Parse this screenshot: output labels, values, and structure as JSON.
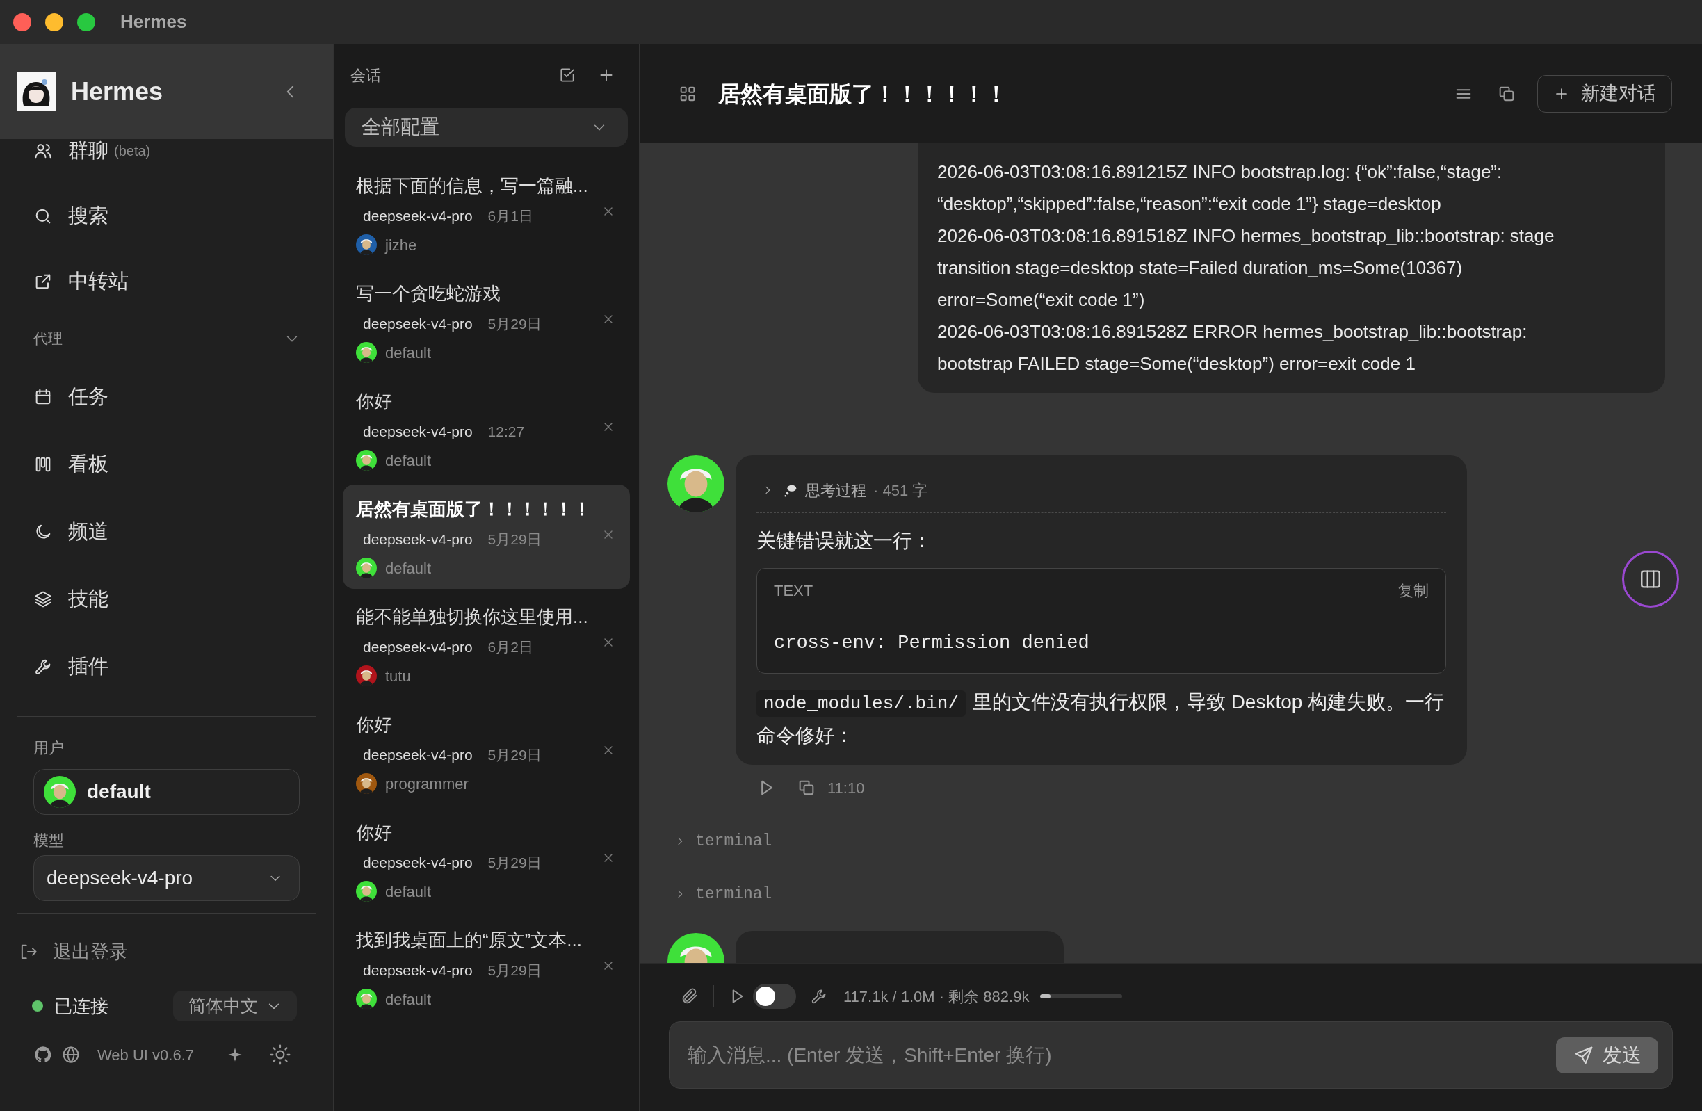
{
  "window": {
    "title": "Hermes"
  },
  "sidebar": {
    "app_name": "Hermes",
    "nav": [
      {
        "label": "群聊",
        "badge": "(beta)"
      },
      {
        "label": "搜索"
      },
      {
        "label": "中转站"
      }
    ],
    "sections": [
      {
        "title": "代理",
        "expanded": true,
        "items": [
          {
            "label": "任务"
          },
          {
            "label": "看板"
          },
          {
            "label": "频道"
          },
          {
            "label": "技能"
          },
          {
            "label": "插件"
          }
        ]
      }
    ],
    "user": {
      "label": "用户",
      "name": "default"
    },
    "model": {
      "label": "模型",
      "value": "deepseek-v4-pro"
    },
    "logout": "退出登录",
    "connection": {
      "label": "已连接",
      "connected": true
    },
    "language": "简体中文",
    "version": "Web UI v0.6.7"
  },
  "conversations": {
    "title": "会话",
    "filter": "全部配置",
    "items": [
      {
        "title": "根据下面的信息，写一篇融...",
        "model": "deepseek-v4-pro",
        "date": "6月1日",
        "user": "jizhe",
        "color": "#1f5fa8",
        "selected": false
      },
      {
        "title": "写一个贪吃蛇游戏",
        "model": "deepseek-v4-pro",
        "date": "5月29日",
        "user": "default",
        "color": "#3fe03a",
        "selected": false
      },
      {
        "title": "你好",
        "model": "deepseek-v4-pro",
        "date": "12:27",
        "user": "default",
        "color": "#3fe03a",
        "selected": false
      },
      {
        "title": "居然有桌面版了！！！！！！",
        "model": "deepseek-v4-pro",
        "date": "5月29日",
        "user": "default",
        "color": "#3fe03a",
        "selected": true
      },
      {
        "title": "能不能单独切换你这里使用...",
        "model": "deepseek-v4-pro",
        "date": "6月2日",
        "user": "tutu",
        "color": "#b0141c",
        "selected": false
      },
      {
        "title": "你好",
        "model": "deepseek-v4-pro",
        "date": "5月29日",
        "user": "programmer",
        "color": "#a0580f",
        "selected": false
      },
      {
        "title": "你好",
        "model": "deepseek-v4-pro",
        "date": "5月29日",
        "user": "default",
        "color": "#3fe03a",
        "selected": false
      },
      {
        "title": "找到我桌面上的“原文”文本...",
        "model": "deepseek-v4-pro",
        "date": "5月29日",
        "user": "default",
        "color": "#3fe03a",
        "selected": false
      }
    ]
  },
  "chat": {
    "title": "居然有桌面版了！！！！！！",
    "new_button": "新建对话",
    "log_lines": [
      "2026-06-03T03:08:16.891215Z INFO bootstrap.log: {“ok”:false,“stage”:",
      "“desktop”,“skipped”:false,“reason”:“exit code 1”} stage=desktop",
      "2026-06-03T03:08:16.891518Z INFO hermes_bootstrap_lib::bootstrap: stage",
      "transition stage=desktop state=Failed duration_ms=Some(10367)",
      "error=Some(“exit code 1”)",
      "2026-06-03T03:08:16.891528Z ERROR hermes_bootstrap_lib::bootstrap:",
      "bootstrap FAILED stage=Some(“desktop”) error=exit code 1"
    ],
    "messages": [
      {
        "kind": "assistant",
        "thinking": "思考过程",
        "thinking_count": "· 451 字",
        "intro": "关键错误就这一行：",
        "code_language": "TEXT",
        "copy": "复制",
        "code": "cross-env: Permission denied",
        "inline_code": "node_modules/.bin/",
        "text": "里的文件没有执行权限，导致 Desktop 构建失败。一行命令修好：",
        "time": "11:10"
      },
      {
        "kind": "tool",
        "label": "terminal"
      },
      {
        "kind": "tool",
        "label": "terminal"
      },
      {
        "kind": "partial"
      }
    ]
  },
  "composer": {
    "stream_on": false,
    "usage": "117.1k / 1.0M · 剩余 882.9k",
    "level": 0.12,
    "placeholder": "输入消息... (Enter 发送，Shift+Enter 换行)",
    "send": "发送"
  }
}
